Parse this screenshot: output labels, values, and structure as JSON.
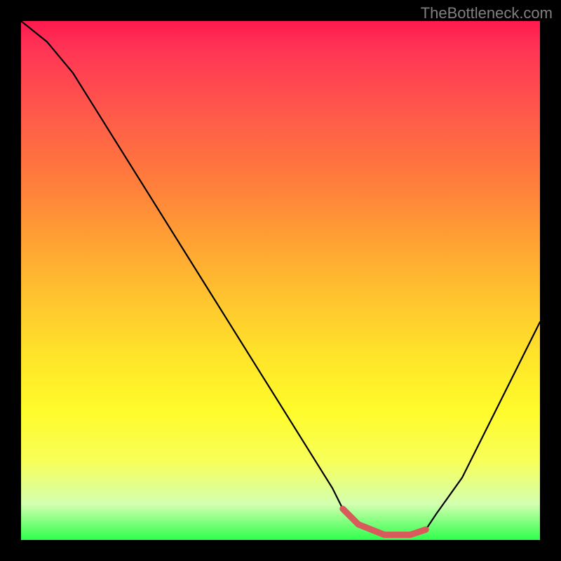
{
  "watermark": "TheBottleneck.com",
  "chart_data": {
    "type": "line",
    "title": "",
    "xlabel": "",
    "ylabel": "",
    "xlim": [
      0,
      100
    ],
    "ylim": [
      0,
      100
    ],
    "series": [
      {
        "name": "bottleneck-curve",
        "x": [
          0,
          5,
          10,
          15,
          20,
          25,
          30,
          35,
          40,
          45,
          50,
          55,
          60,
          62,
          65,
          70,
          75,
          78,
          80,
          85,
          90,
          95,
          100
        ],
        "values": [
          100,
          96,
          90,
          82,
          74,
          66,
          58,
          50,
          42,
          34,
          26,
          18,
          10,
          6,
          3,
          1,
          1,
          2,
          5,
          12,
          22,
          32,
          42
        ]
      }
    ],
    "highlight_range": {
      "start_x": 62,
      "end_x": 78,
      "color": "#e06060",
      "note": "optimal-zone-marker"
    },
    "background_gradient": {
      "top": "#ff1a4d",
      "middle": "#ffe52a",
      "bottom": "#2eff4c"
    }
  }
}
